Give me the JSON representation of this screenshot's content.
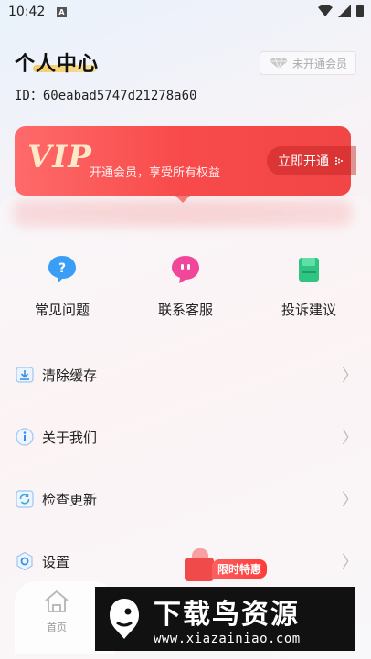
{
  "status_bar": {
    "time": "10:42",
    "notification_icon": "A"
  },
  "header": {
    "title": "个人中心",
    "uid_label": "ID：60eabad5747d21278a60",
    "member_status": "未开通会员"
  },
  "vip": {
    "logo": "VIP",
    "tagline": "开通会员，享受所有权益",
    "button_label": "立即开通"
  },
  "quick_actions": [
    {
      "label": "常见问题",
      "icon": "help-bubble-icon",
      "color": "#3a9ef6"
    },
    {
      "label": "联系客服",
      "icon": "chat-bubble-icon",
      "color": "#f0479a"
    },
    {
      "label": "投诉建议",
      "icon": "feedback-icon",
      "color": "#2fc481"
    }
  ],
  "menu": [
    {
      "label": "清除缓存",
      "icon": "download-tray-icon"
    },
    {
      "label": "关于我们",
      "icon": "info-icon"
    },
    {
      "label": "检查更新",
      "icon": "refresh-icon"
    },
    {
      "label": "设置",
      "icon": "settings-icon"
    }
  ],
  "tabbar": {
    "home_label": "首页"
  },
  "promo": {
    "label": "限时特惠"
  },
  "watermark": {
    "title": "下载鸟资源",
    "url": "www.xiazainiao.com"
  }
}
